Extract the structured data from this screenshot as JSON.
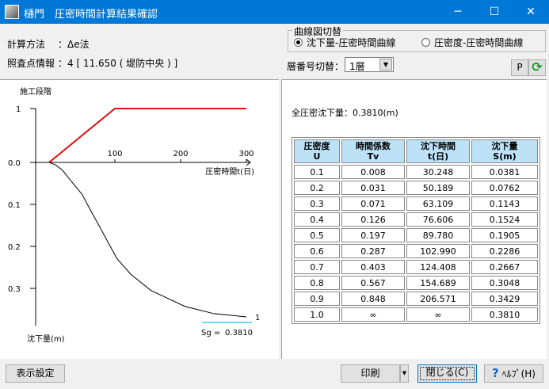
{
  "window": {
    "title": "樋門　圧密時間計算結果確認",
    "minimize": "─",
    "maximize": "☐",
    "close": "✕"
  },
  "info": {
    "method_label": "計算方法",
    "method_value": "：Δe法",
    "point_label": "照査点情報",
    "point_value": "：4 [ 11.650 ( 堤防中央 ) ]"
  },
  "curve_switch": {
    "title": "曲線図切替",
    "options": [
      "沈下量-圧密時間曲線",
      "圧密度-圧密時間曲線"
    ],
    "selected": 0
  },
  "layer": {
    "label": "層番号切替：",
    "value": "1層"
  },
  "buttons": {
    "p": "P",
    "display_settings": "表示設定",
    "print": "印刷",
    "close": "閉じる(C)",
    "help": "ﾍﾙﾌﾟ(H)"
  },
  "summary": "全圧密沈下量：0.3810(m)",
  "table": {
    "headers": [
      [
        "圧密度",
        "U"
      ],
      [
        "時間係数",
        "Tv"
      ],
      [
        "沈下時間",
        "t(日)"
      ],
      [
        "沈下量",
        "S(m)"
      ]
    ],
    "rows": [
      [
        "0.1",
        "0.008",
        "30.248",
        "0.0381"
      ],
      [
        "0.2",
        "0.031",
        "50.189",
        "0.0762"
      ],
      [
        "0.3",
        "0.071",
        "63.109",
        "0.1143"
      ],
      [
        "0.4",
        "0.126",
        "76.606",
        "0.1524"
      ],
      [
        "0.5",
        "0.197",
        "89.780",
        "0.1905"
      ],
      [
        "0.6",
        "0.287",
        "102.990",
        "0.2286"
      ],
      [
        "0.7",
        "0.403",
        "124.408",
        "0.2667"
      ],
      [
        "0.8",
        "0.567",
        "154.689",
        "0.3048"
      ],
      [
        "0.9",
        "0.848",
        "206.571",
        "0.3429"
      ],
      [
        "1.0",
        "∞",
        "∞",
        "0.3810"
      ]
    ]
  },
  "chart_data": {
    "type": "line",
    "title": "施工段階",
    "xlabel": "圧密時間t(日)",
    "ylabel": "沈下量(m)",
    "xlim": [
      0,
      300
    ],
    "ylim": [
      0,
      0.38
    ],
    "x_ticks": [
      "100",
      "200",
      "300"
    ],
    "y_ticks": [
      "0.0",
      "0.1",
      "0.2",
      "0.3"
    ],
    "stage_tick": "1",
    "series": [
      {
        "name": "施工段階",
        "color": "#e01010",
        "points": [
          [
            0,
            0
          ],
          [
            100,
            1
          ],
          [
            300,
            1
          ]
        ]
      },
      {
        "name": "1",
        "color": "#000000",
        "points": [
          [
            0,
            0
          ],
          [
            10,
            0.006
          ],
          [
            20,
            0.018
          ],
          [
            30.248,
            0.0381
          ],
          [
            50.189,
            0.0762
          ],
          [
            63.109,
            0.1143
          ],
          [
            76.606,
            0.1524
          ],
          [
            89.78,
            0.1905
          ],
          [
            102.99,
            0.2286
          ],
          [
            124.408,
            0.2667
          ],
          [
            154.689,
            0.3048
          ],
          [
            206.571,
            0.3429
          ],
          [
            250,
            0.36
          ],
          [
            300,
            0.368
          ]
        ]
      }
    ],
    "sg_label": "Sg =",
    "sg_value": "0.3810",
    "sg_color": "#40d0e0"
  }
}
